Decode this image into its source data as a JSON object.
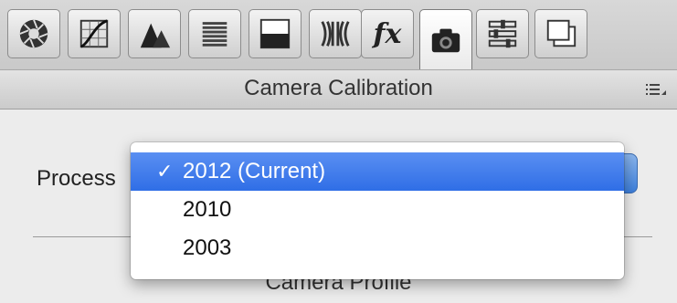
{
  "toolbar": {
    "tools": [
      {
        "name": "basic-icon"
      },
      {
        "name": "tone-curve-icon"
      },
      {
        "name": "detail-icon"
      },
      {
        "name": "hsl-grayscale-icon"
      },
      {
        "name": "split-toning-icon"
      },
      {
        "name": "lens-corrections-icon"
      },
      {
        "name": "effects-icon",
        "label": "fx"
      },
      {
        "name": "camera-icon"
      },
      {
        "name": "presets-icon"
      },
      {
        "name": "snapshots-icon"
      }
    ],
    "active_tool": "camera-icon"
  },
  "panel": {
    "title": "Camera Calibration",
    "process_label": "Process",
    "section_title": "Camera Profile"
  },
  "process_menu": {
    "items": [
      {
        "label": "2012 (Current)",
        "checked": true
      },
      {
        "label": "2010",
        "checked": false
      },
      {
        "label": "2003",
        "checked": false
      }
    ],
    "check_mark": "✓"
  },
  "colors": {
    "selection": "#2f6ee6",
    "toolbar": "#c9c9c9",
    "panel_bg": "#ececec"
  }
}
